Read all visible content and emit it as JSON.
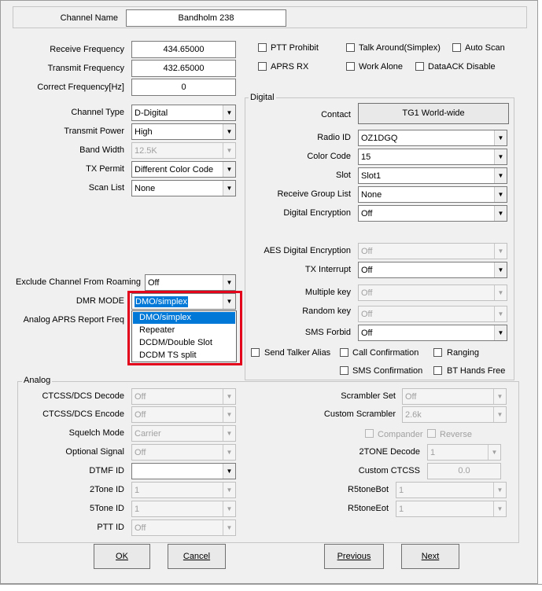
{
  "header": {
    "channel_name_label": "Channel Name",
    "channel_name_value": "Bandholm 238"
  },
  "freq": {
    "receive_label": "Receive Frequency",
    "receive_value": "434.65000",
    "transmit_label": "Transmit Frequency",
    "transmit_value": "432.65000",
    "correct_label": "Correct Frequency[Hz]",
    "correct_value": "0"
  },
  "checks": {
    "ptt_prohibit": "PTT Prohibit",
    "talk_around": "Talk Around(Simplex)",
    "auto_scan": "Auto Scan",
    "aprs_rx": "APRS RX",
    "work_alone": "Work Alone",
    "dataack_disable": "DataACK Disable"
  },
  "left": {
    "channel_type_label": "Channel Type",
    "channel_type_value": "D-Digital",
    "transmit_power_label": "Transmit Power",
    "transmit_power_value": "High",
    "band_width_label": "Band Width",
    "band_width_value": "12.5K",
    "tx_permit_label": "TX Permit",
    "tx_permit_value": "Different Color Code",
    "scan_list_label": "Scan List",
    "scan_list_value": "None",
    "exclude_label": "Exclude Channel From Roaming",
    "exclude_value": "Off",
    "dmr_mode_label": "DMR MODE",
    "dmr_mode_value": "DMO/simplex",
    "analog_aprs_label": "Analog APRS Report Freq"
  },
  "dropdown": {
    "options": [
      "DMO/simplex",
      "Repeater",
      "DCDM/Double Slot",
      "DCDM TS split"
    ]
  },
  "digital": {
    "title": "Digital",
    "contact_label": "Contact",
    "contact_value": "TG1 World-wide",
    "radio_id_label": "Radio ID",
    "radio_id_value": "OZ1DGQ",
    "color_code_label": "Color Code",
    "color_code_value": "15",
    "slot_label": "Slot",
    "slot_value": "Slot1",
    "rx_group_label": "Receive Group List",
    "rx_group_value": "None",
    "digital_enc_label": "Digital Encryption",
    "digital_enc_value": "Off",
    "aes_label": "AES Digital Encryption",
    "aes_value": "Off",
    "tx_interrupt_label": "TX Interrupt",
    "tx_interrupt_value": "Off",
    "multiple_key_label": "Multiple key",
    "multiple_key_value": "Off",
    "random_key_label": "Random key",
    "random_key_value": "Off",
    "sms_forbid_label": "SMS Forbid",
    "sms_forbid_value": "Off",
    "send_talker_alias": "Send Talker Alias",
    "call_confirmation": "Call Confirmation",
    "ranging": "Ranging",
    "sms_confirmation": "SMS Confirmation",
    "bt_hands_free": "BT Hands Free"
  },
  "analog": {
    "title": "Analog",
    "ctcss_decode_label": "CTCSS/DCS Decode",
    "ctcss_decode_value": "Off",
    "ctcss_encode_label": "CTCSS/DCS Encode",
    "ctcss_encode_value": "Off",
    "squelch_label": "Squelch Mode",
    "squelch_value": "Carrier",
    "optional_signal_label": "Optional Signal",
    "optional_signal_value": "Off",
    "dtmf_id_label": "DTMF ID",
    "dtmf_id_value": "",
    "two_tone_id_label": "2Tone ID",
    "two_tone_id_value": "1",
    "five_tone_id_label": "5Tone ID",
    "five_tone_id_value": "1",
    "ptt_id_label": "PTT ID",
    "ptt_id_value": "Off",
    "scrambler_set_label": "Scrambler Set",
    "scrambler_set_value": "Off",
    "custom_scrambler_label": "Custom Scrambler",
    "custom_scrambler_value": "2.6k",
    "compander": "Compander",
    "reverse": "Reverse",
    "two_tone_decode_label": "2TONE Decode",
    "two_tone_decode_value": "1",
    "custom_ctcss_label": "Custom CTCSS",
    "custom_ctcss_value": "0.0",
    "r5_bot_label": "R5toneBot",
    "r5_bot_value": "1",
    "r5_eot_label": "R5toneEot",
    "r5_eot_value": "1"
  },
  "buttons": {
    "ok": "OK",
    "cancel": "Cancel",
    "previous": "Previous",
    "next": "Next"
  },
  "colors": {
    "highlight": "#0078d7",
    "annotation_red": "#e3001b"
  }
}
